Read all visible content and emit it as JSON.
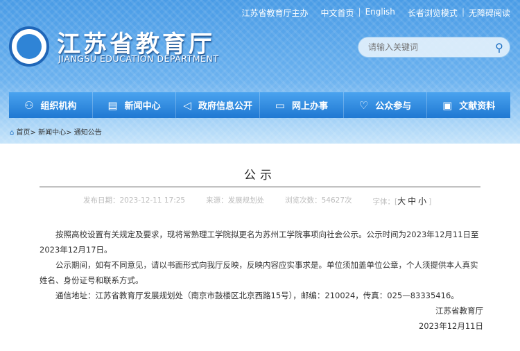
{
  "top_links": {
    "host": "江苏省教育厅主办",
    "home": "中文首页",
    "english": "English",
    "elderly": "长者浏览模式",
    "accessible": "无障碍阅读",
    "sep": "|"
  },
  "site": {
    "title": "江苏省教育厅",
    "subtitle": "JIANGSU EDUCATION DEPARTMENT"
  },
  "search": {
    "placeholder": "请输入关键词"
  },
  "nav": [
    {
      "label": "组织机构",
      "icon": "⚇"
    },
    {
      "label": "新闻中心",
      "icon": "▤"
    },
    {
      "label": "政府信息公开",
      "icon": "◁"
    },
    {
      "label": "网上办事",
      "icon": "▭"
    },
    {
      "label": "公众参与",
      "icon": "♡"
    },
    {
      "label": "文献资料",
      "icon": "▣"
    }
  ],
  "breadcrumb": [
    "首页>",
    "新闻中心>",
    "通知公告"
  ],
  "article": {
    "title": "公示",
    "date": "发布日期：2023-12-11 17:25",
    "source": "来源：发展规划处",
    "views": "浏览次数：54627次",
    "font_label": "字体：[",
    "font_large": "大",
    "font_medium": "中",
    "font_small": "小",
    "font_end": "]",
    "paragraphs": [
      "按照高校设置有关规定及要求，现将常熟理工学院拟更名为苏州工学院事项向社会公示。公示时间为2023年12月11日至2023年12月17日。",
      "公示期间，如有不同意见，请以书面形式向我厅反映，反映内容应实事求是。单位须加盖单位公章，个人须提供本人真实姓名、身份证号和联系方式。",
      "通信地址：江苏省教育厅发展规划处（南京市鼓楼区北京西路15号），邮编：210024，传真：025—83335416。"
    ],
    "signature": "江苏省教育厅",
    "sign_date": "2023年12月11日"
  }
}
